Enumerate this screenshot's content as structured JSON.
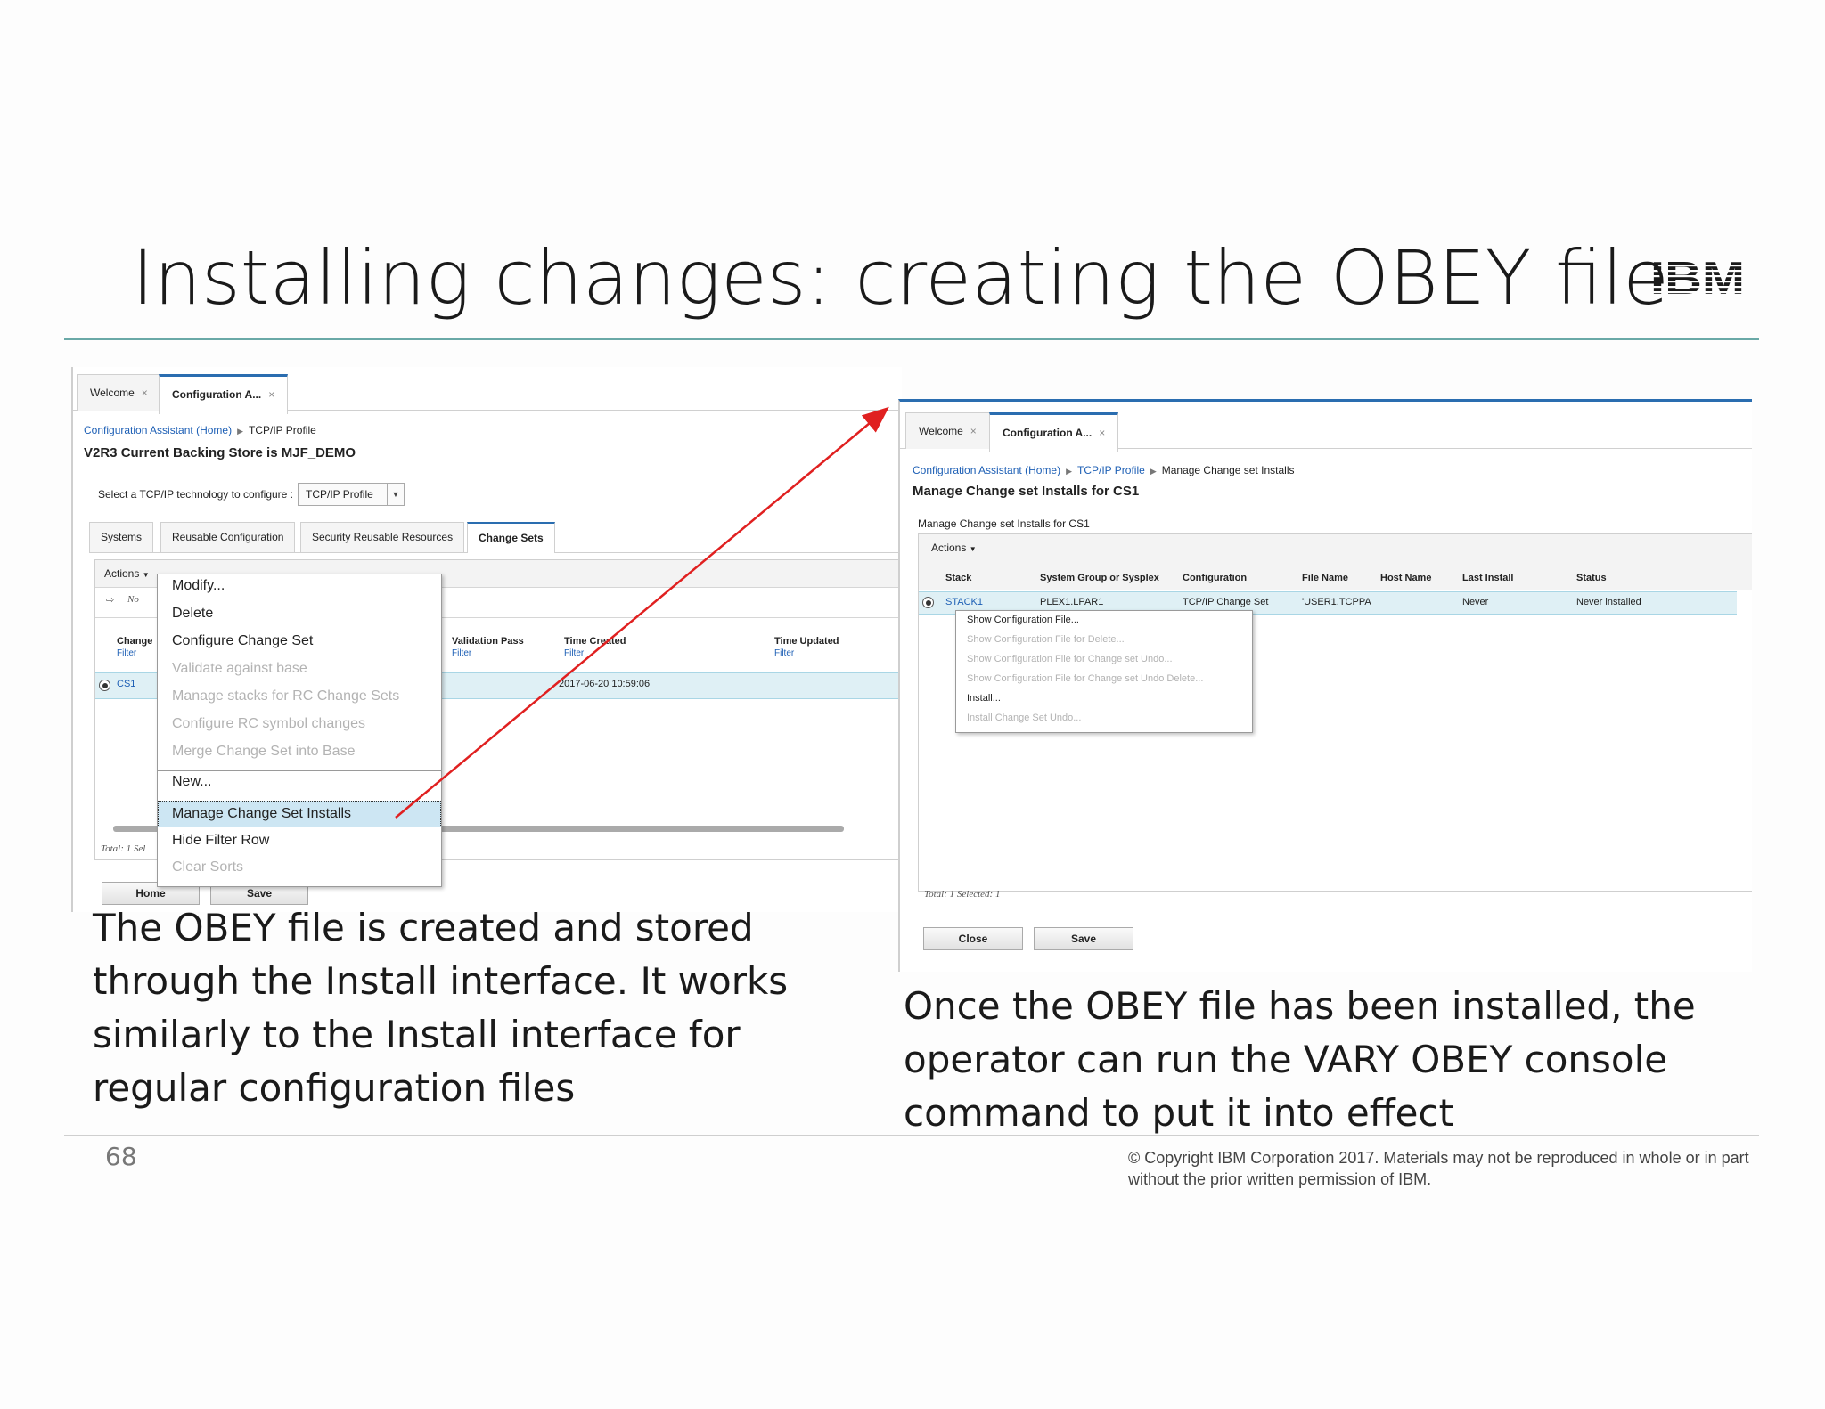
{
  "slide": {
    "title": "Installing changes: creating the OBEY file",
    "logo_text": "IBM",
    "caption_left": "The OBEY file is created and stored through the Install interface.  It works similarly to the Install interface for regular configuration files",
    "caption_right": "Once the OBEY file has been installed, the operator can run the VARY OBEY console command to put it into effect",
    "page_number": "68",
    "copyright": "© Copyright IBM Corporation 2017.  Materials may not be reproduced in whole or in part without the prior written permission of IBM."
  },
  "colors": {
    "accent_rule": "#6aa9a7",
    "link": "#1d5fb5",
    "selected_row": "#dff0f5",
    "arrow": "#e02020"
  },
  "left_screen": {
    "tabs": [
      {
        "label": "Welcome",
        "close": "×"
      },
      {
        "label": "Configuration A...",
        "close": "×"
      }
    ],
    "breadcrumb": {
      "home": "Configuration Assistant (Home)",
      "current": "TCP/IP Profile"
    },
    "heading": "V2R3 Current Backing Store is MJF_DEMO",
    "select_label": "Select a TCP/IP technology to configure :",
    "select_value": "TCP/IP Profile",
    "subtabs": [
      "Systems",
      "Reusable Configuration",
      "Security Reusable Resources",
      "Change Sets"
    ],
    "actions_label": "Actions",
    "no_filter_text": "No",
    "columns": [
      {
        "name": "Change",
        "filter": "Filter"
      },
      {
        "name": "Validation Pass",
        "filter": "Filter"
      },
      {
        "name": "Time Created",
        "filter": "Filter"
      },
      {
        "name": "Time Updated",
        "filter": "Filter"
      }
    ],
    "row": {
      "name": "CS1",
      "time_created": "2017-06-20 10:59:06"
    },
    "total_text": "Total: 1 Sel",
    "buttons": {
      "home": "Home",
      "save": "Save"
    },
    "context_menu": [
      {
        "label": "Modify...",
        "state": "enabled"
      },
      {
        "label": "Delete",
        "state": "enabled"
      },
      {
        "label": "Configure Change Set",
        "state": "enabled"
      },
      {
        "label": "Validate against base",
        "state": "disabled"
      },
      {
        "label": "Manage stacks for RC Change Sets",
        "state": "disabled"
      },
      {
        "label": "Configure RC symbol changes",
        "state": "disabled"
      },
      {
        "label": "Merge Change Set into Base",
        "state": "disabled"
      },
      {
        "label": "New...",
        "state": "enabled"
      },
      {
        "label": "Manage Change Set Installs",
        "state": "highlighted"
      },
      {
        "label": "Hide Filter Row",
        "state": "enabled"
      },
      {
        "label": "Clear Sorts",
        "state": "disabled"
      }
    ]
  },
  "right_screen": {
    "tabs": [
      {
        "label": "Welcome",
        "close": "×"
      },
      {
        "label": "Configuration A...",
        "close": "×"
      }
    ],
    "breadcrumb": {
      "home": "Configuration Assistant (Home)",
      "middle": "TCP/IP Profile",
      "current": "Manage Change set Installs"
    },
    "heading": "Manage Change set Installs for CS1",
    "subheading": "Manage Change set Installs for CS1",
    "actions_label": "Actions",
    "columns": [
      "Stack",
      "System Group or Sysplex",
      "Configuration",
      "File Name",
      "Host Name",
      "Last Install",
      "Status"
    ],
    "row": {
      "stack": "STACK1",
      "group": "PLEX1.LPAR1",
      "configuration": "TCP/IP Change Set",
      "file_name": "'USER1.TCPPA",
      "host_name": "",
      "last_install": "Never",
      "status": "Never installed"
    },
    "total_text": "Total: 1 Selected: 1",
    "buttons": {
      "close": "Close",
      "save": "Save"
    },
    "context_menu": [
      {
        "label": "Show Configuration File...",
        "state": "enabled"
      },
      {
        "label": "Show Configuration File for Delete...",
        "state": "disabled"
      },
      {
        "label": "Show Configuration File for Change set Undo...",
        "state": "disabled"
      },
      {
        "label": "Show Configuration File for Change set Undo Delete...",
        "state": "disabled"
      },
      {
        "label": "Install...",
        "state": "enabled"
      },
      {
        "label": "Install Change Set Undo...",
        "state": "disabled"
      }
    ]
  }
}
